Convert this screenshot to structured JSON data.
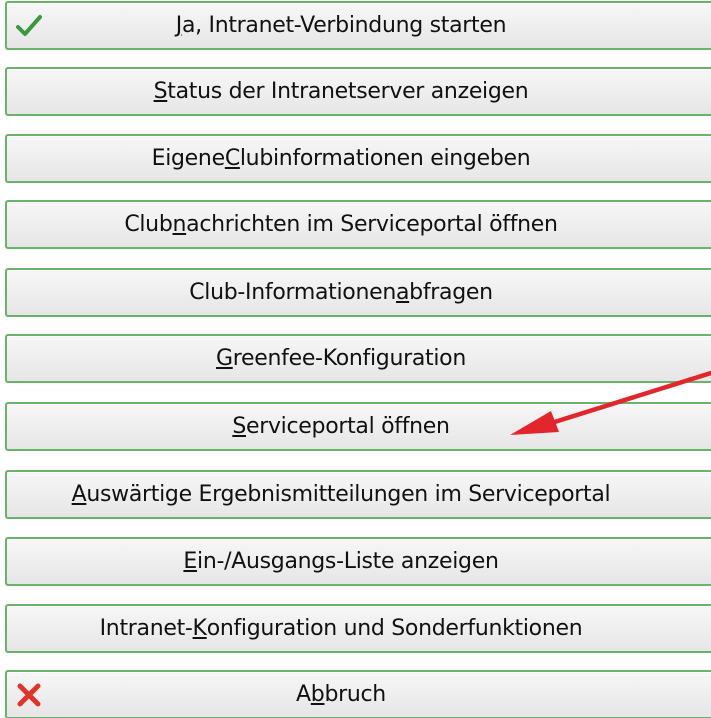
{
  "buttons": [
    {
      "id": "start",
      "pre": "",
      "u": "J",
      "post": "a, Intranet-Verbindung starten",
      "icon": "checkmark-icon"
    },
    {
      "id": "status",
      "pre": "",
      "u": "S",
      "post": "tatus der Intranetserver anzeigen"
    },
    {
      "id": "club-info-input",
      "pre": "Eigene ",
      "u": "C",
      "post": "lubinformationen eingeben"
    },
    {
      "id": "club-messages",
      "pre": "Club",
      "u": "n",
      "post": "achrichten im Serviceportal öffnen"
    },
    {
      "id": "club-info-query",
      "pre": "Club-Informationen ",
      "u": "a",
      "post": "bfragen"
    },
    {
      "id": "greenfee",
      "pre": "",
      "u": "G",
      "post": "reenfee-Konfiguration"
    },
    {
      "id": "serviceportal",
      "pre": "",
      "u": "S",
      "post": "erviceportal öffnen"
    },
    {
      "id": "external-results",
      "pre": "",
      "u": "A",
      "post": "uswärtige Ergebnismitteilungen im Serviceportal"
    },
    {
      "id": "in-out-list",
      "pre": "",
      "u": "E",
      "post": "in-/Ausgangs-Liste anzeigen"
    },
    {
      "id": "intranet-config",
      "pre": "Intranet-",
      "u": "K",
      "post": "onfiguration und Sonderfunktionen"
    },
    {
      "id": "cancel",
      "pre": "A",
      "u": "b",
      "post": "bruch",
      "icon": "red-x-icon"
    }
  ],
  "colors": {
    "border": "#6bb36b",
    "check": "#3a9a3a",
    "cancel_x": "#e0342a",
    "arrow": "#e3262b"
  },
  "annotation": {
    "icon": "red-arrow-icon",
    "points_to": "serviceportal"
  }
}
